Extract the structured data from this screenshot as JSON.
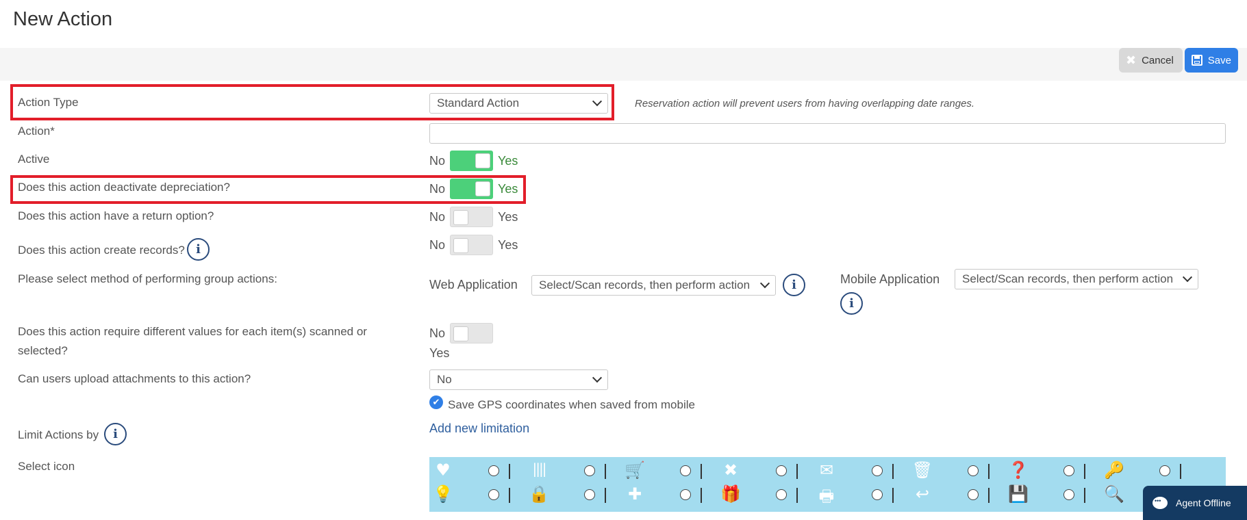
{
  "page": {
    "title": "New Action"
  },
  "toolbar": {
    "cancel_label": "Cancel",
    "save_label": "Save"
  },
  "form": {
    "action_type": {
      "label": "Action Type",
      "value": "Standard Action",
      "hint": "Reservation action will prevent users from having overlapping date ranges."
    },
    "action": {
      "label": "Action*",
      "value": ""
    },
    "active": {
      "label": "Active",
      "no": "No",
      "yes": "Yes",
      "on": true
    },
    "deactivate_depreciation": {
      "label": "Does this action deactivate depreciation?",
      "no": "No",
      "yes": "Yes",
      "on": true
    },
    "return_option": {
      "label": "Does this action have a return option?",
      "no": "No",
      "yes": "Yes",
      "on": false
    },
    "create_records": {
      "label": "Does this action create records?",
      "no": "No",
      "yes": "Yes",
      "on": false
    },
    "group_actions": {
      "label": "Please select method of performing group actions:",
      "web_label": "Web Application",
      "web_value": "Select/Scan records, then perform action",
      "mobile_label": "Mobile Application",
      "mobile_value": "Select/Scan records, then perform action"
    },
    "different_values": {
      "label_line1": "Does this action require different values for each item(s) scanned or",
      "label_line2": "selected?",
      "no": "No",
      "yes": "Yes",
      "on": false
    },
    "attachments": {
      "label": "Can users upload attachments to this action?",
      "value": "No"
    },
    "gps": {
      "label": "Save GPS coordinates when saved from mobile",
      "checked": true
    },
    "limit_actions": {
      "label": "Limit Actions by",
      "link": "Add new limitation"
    },
    "select_icon": {
      "label": "Select icon"
    }
  },
  "icons": {
    "row1": [
      "heart-icon",
      "barcode-icon",
      "cart-icon",
      "close-x-icon",
      "envelope-icon",
      "trash-icon",
      "question-circle-icon",
      "key-icon"
    ],
    "row2": [
      "lightbulb-icon",
      "lock-icon",
      "plus-icon",
      "gift-icon",
      "printer-icon",
      "undo-icon",
      "floppy-disk-icon",
      "search-icon"
    ]
  },
  "chat": {
    "label": "Agent Offline"
  },
  "colors": {
    "accent": "#2f7fe6",
    "toggle_on": "#4cd07a",
    "highlight": "#e21e2a",
    "icon_panel": "#a3dcef",
    "chat": "#143a62"
  }
}
